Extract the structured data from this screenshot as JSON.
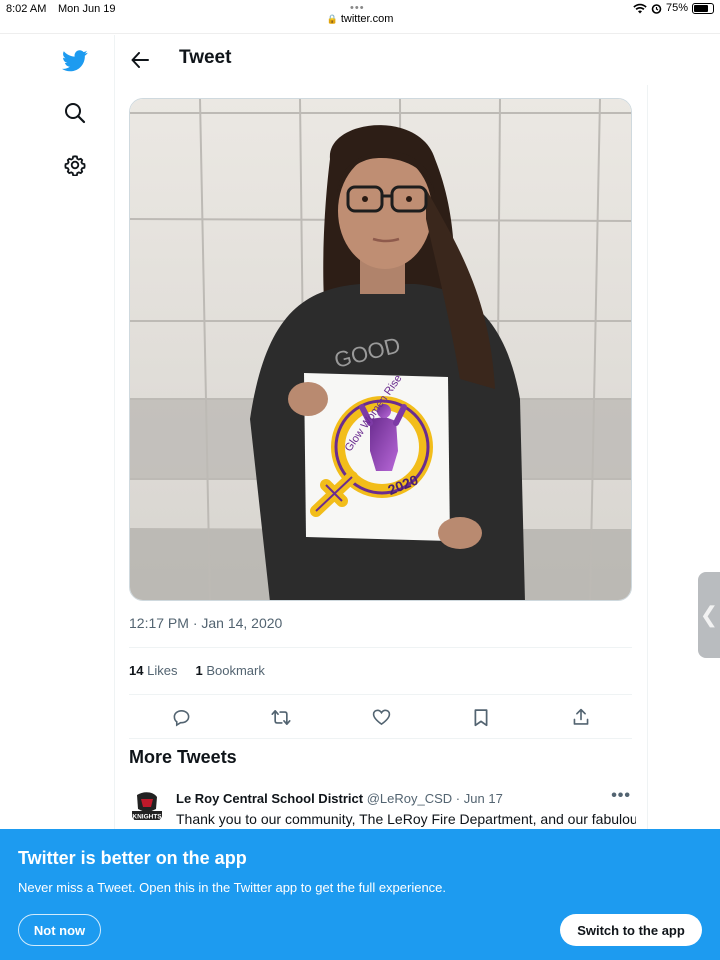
{
  "status_bar": {
    "time": "8:02 AM",
    "date": "Mon Jun 19",
    "url": "twitter.com",
    "battery": "75%",
    "battery_level": 0.75
  },
  "nav": {
    "icons": [
      "twitter-bird-icon",
      "search-icon",
      "settings-gear-icon"
    ]
  },
  "header": {
    "title": "Tweet"
  },
  "tweet": {
    "timestamp": "12:17 PM · Jan 14, 2020",
    "likes_count": "14",
    "likes_label": "Likes",
    "bookmarks_count": "1",
    "bookmarks_label": "Bookmark",
    "photo": {
      "shirt_text": "GOOD",
      "sign_text": "Glow Women Rise",
      "sign_year": "2020"
    }
  },
  "more_tweets": {
    "title": "More Tweets",
    "items": [
      {
        "author": "Le Roy Central School District",
        "handle": "@LeRoy_CSD",
        "date": "Jun 17",
        "text": "Thank you to our community, The LeRoy Fire Department, and our fabulous",
        "avatar_text": "KNIGHTS"
      }
    ]
  },
  "app_banner": {
    "title": "Twitter is better on the app",
    "subtitle": "Never miss a Tweet. Open this in the Twitter app to get the full experience.",
    "not_now": "Not now",
    "switch": "Switch to the app"
  },
  "colors": {
    "brand": "#1d9bf0",
    "text": "#0f1419",
    "muted": "#536471"
  }
}
